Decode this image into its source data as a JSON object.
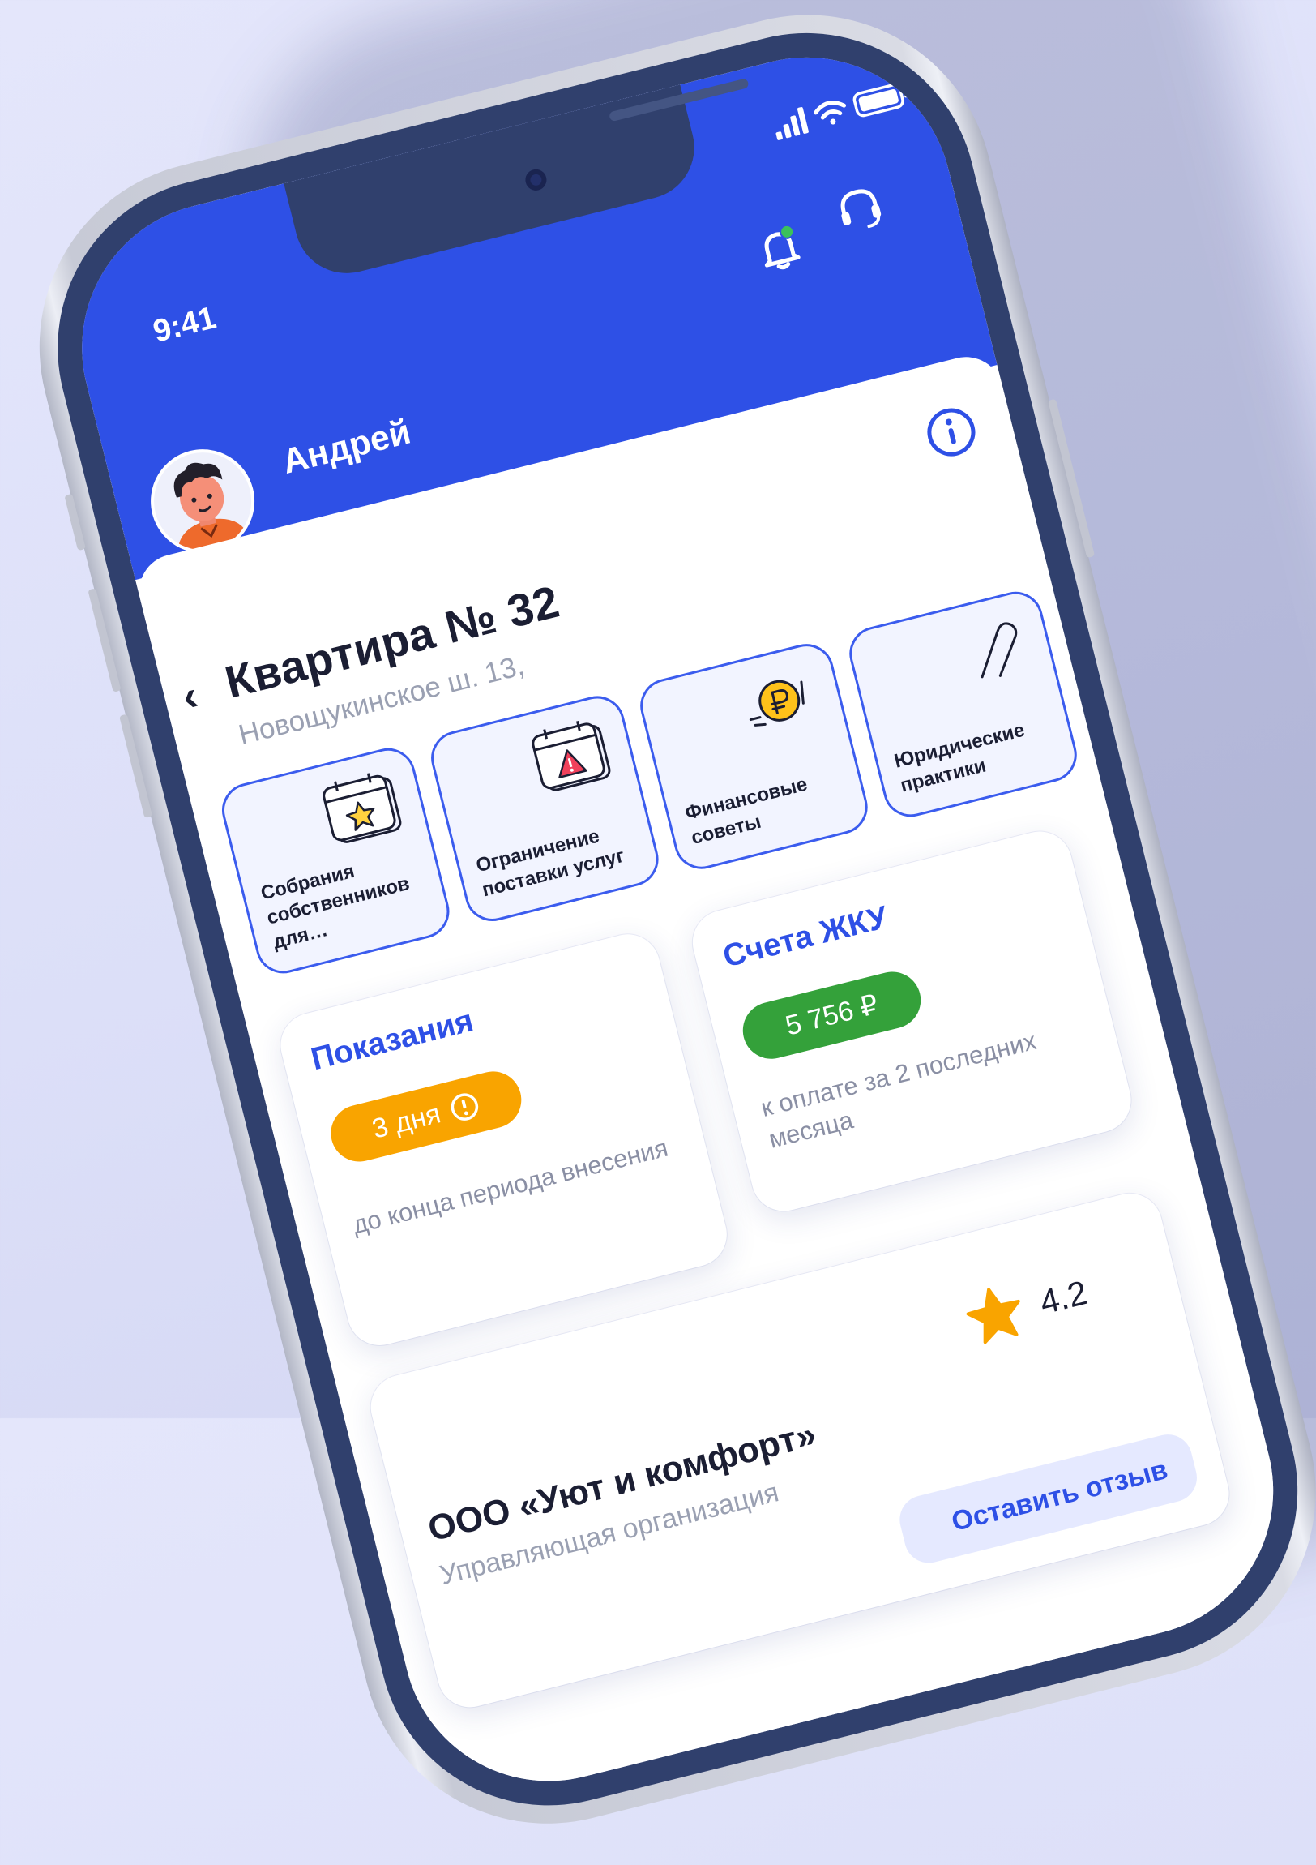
{
  "status_bar": {
    "time": "9:41"
  },
  "header": {
    "user_name": "Андрей"
  },
  "apartment": {
    "title": "Квартира № 32",
    "address": "Новощукинское ш. 13,"
  },
  "tiles": [
    {
      "label": "Собрания собственников для…",
      "icon": "calendar-star-icon"
    },
    {
      "label": "Ограничение поставки услуг",
      "icon": "calendar-warning-icon"
    },
    {
      "label": "Финансовые советы",
      "icon": "ruble-coin-icon"
    },
    {
      "label": "Юридические практики",
      "icon": "paperclip-icon"
    }
  ],
  "readings": {
    "title": "Показания",
    "badge": "3 дня",
    "description": "до конца периода внесения",
    "badge_color": "#f9a400"
  },
  "bills": {
    "title": "Счета ЖКУ",
    "amount": "5 756 ₽",
    "description": "к оплате за 2 последних месяца",
    "amount_color": "#34a13a"
  },
  "company": {
    "name": "ООО «Уют и комфорт»",
    "subtitle": "Управляющая организация",
    "rating": "4.2",
    "review_button": "Оставить отзыв"
  },
  "colors": {
    "accent": "#2e50e6",
    "warning": "#f9a400",
    "success": "#34a13a",
    "star": "#f9a400"
  }
}
